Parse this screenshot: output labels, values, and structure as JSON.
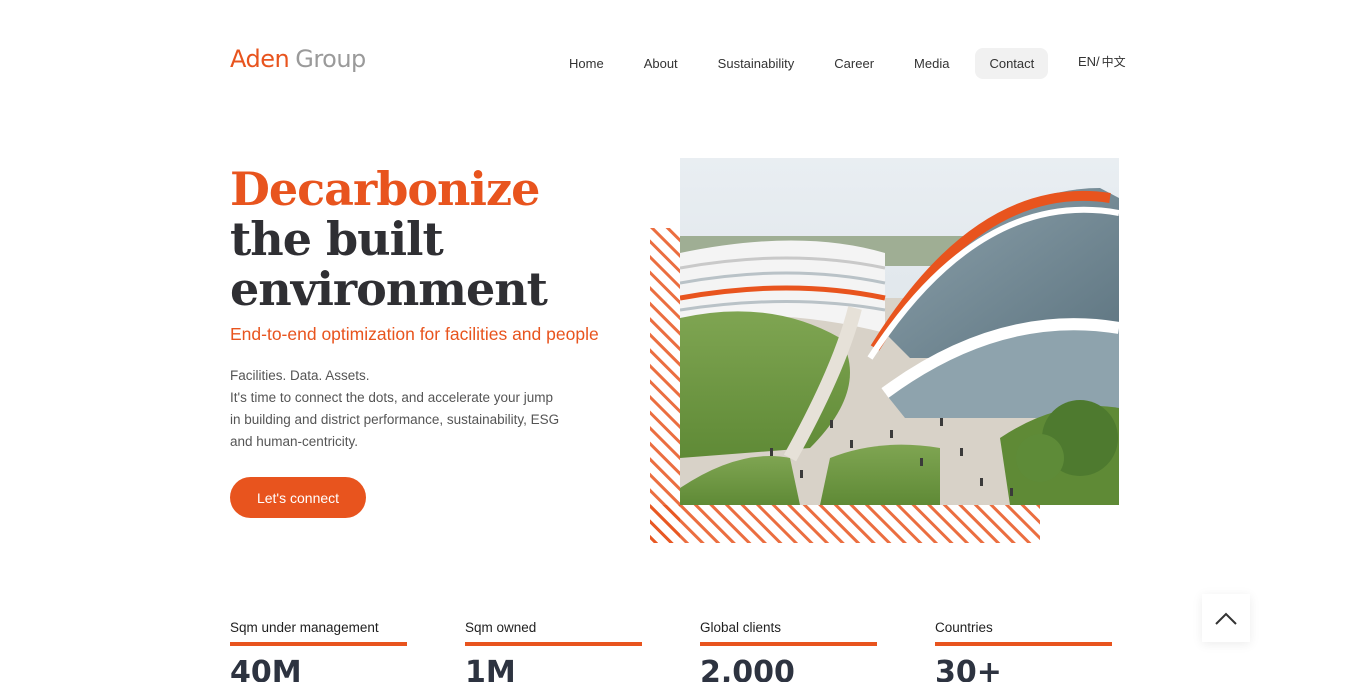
{
  "header": {
    "logo_brand": "Aden",
    "logo_group": "Group",
    "nav": [
      "Home",
      "About",
      "Sustainability",
      "Career",
      "Media",
      "Contact"
    ],
    "nav_active": "Contact",
    "lang_en": "EN/",
    "lang_cn": "中文"
  },
  "hero": {
    "title_accent": "Decarbonize",
    "title_line2": "the built",
    "title_line3": "environment",
    "subtitle": "End-to-end optimization for facilities and people",
    "desc_line1": "Facilities. Data. Assets.",
    "desc_line2": "It's time to connect the dots, and accelerate your jump in building and district performance, sustainability, ESG and human-centricity.",
    "cta_label": "Let's connect"
  },
  "stats": [
    {
      "label": "Sqm under management",
      "value": "40M"
    },
    {
      "label": "Sqm owned",
      "value": "1M"
    },
    {
      "label": "Global clients",
      "value": "2,000"
    },
    {
      "label": "Countries",
      "value": "30+"
    }
  ],
  "colors": {
    "accent": "#e8541e",
    "dark_text": "#2f2f33",
    "nav_active_bg": "#f1f1f1"
  },
  "icons": {
    "scroll_top": "chevron-up-icon"
  }
}
